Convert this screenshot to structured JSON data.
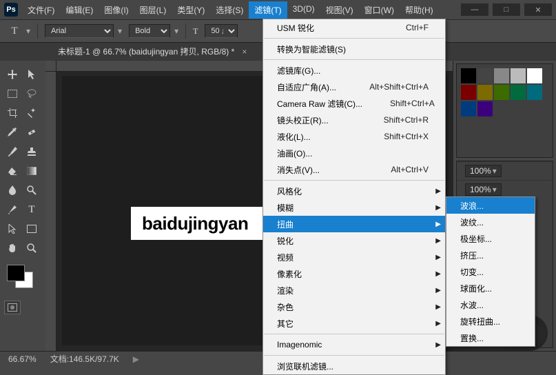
{
  "app_logo": "Ps",
  "menubar": [
    "文件(F)",
    "编辑(E)",
    "图像(I)",
    "图层(L)",
    "类型(Y)",
    "选择(S)",
    "滤镜(T)",
    "3D(D)",
    "视图(V)",
    "窗口(W)",
    "帮助(H)"
  ],
  "active_menu_index": 6,
  "options": {
    "tool_glyph": "T",
    "font_family": "Arial",
    "font_weight": "Bold",
    "size_glyph": "T",
    "size_value": "50 点"
  },
  "document_tab": {
    "label": "未标题-1 @ 66.7% (baidujingyan 拷贝, RGB/8) *",
    "close": "×"
  },
  "canvas_text": "baidujingyan",
  "status": {
    "zoom": "66.67%",
    "doc": "文档:146.5K/97.7K"
  },
  "menu_main": [
    {
      "label": "USM 锐化",
      "shortcut": "Ctrl+F"
    },
    {
      "sep": true
    },
    {
      "label": "转换为智能滤镜(S)"
    },
    {
      "sep": true
    },
    {
      "label": "滤镜库(G)..."
    },
    {
      "label": "自适应广角(A)...",
      "shortcut": "Alt+Shift+Ctrl+A"
    },
    {
      "label": "Camera Raw 滤镜(C)...",
      "shortcut": "Shift+Ctrl+A"
    },
    {
      "label": "镜头校正(R)...",
      "shortcut": "Shift+Ctrl+R"
    },
    {
      "label": "液化(L)...",
      "shortcut": "Shift+Ctrl+X"
    },
    {
      "label": "油画(O)..."
    },
    {
      "label": "消失点(V)...",
      "shortcut": "Alt+Ctrl+V"
    },
    {
      "sep": true
    },
    {
      "label": "风格化",
      "sub": true
    },
    {
      "label": "模糊",
      "sub": true
    },
    {
      "label": "扭曲",
      "sub": true,
      "hov": true
    },
    {
      "label": "锐化",
      "sub": true
    },
    {
      "label": "视频",
      "sub": true
    },
    {
      "label": "像素化",
      "sub": true
    },
    {
      "label": "渲染",
      "sub": true
    },
    {
      "label": "杂色",
      "sub": true
    },
    {
      "label": "其它",
      "sub": true
    },
    {
      "sep": true
    },
    {
      "label": "Imagenomic",
      "sub": true
    },
    {
      "sep": true
    },
    {
      "label": "浏览联机滤镜..."
    }
  ],
  "menu_sub": [
    {
      "label": "波浪...",
      "hov": true
    },
    {
      "label": "波纹..."
    },
    {
      "label": "极坐标..."
    },
    {
      "label": "挤压..."
    },
    {
      "label": "切变..."
    },
    {
      "label": "球面化..."
    },
    {
      "label": "水波..."
    },
    {
      "label": "旋转扭曲..."
    },
    {
      "label": "置换..."
    }
  ],
  "swatches_row1": [
    "#000",
    "#444",
    "#888",
    "#bbb",
    "#fff",
    "#7a0000"
  ],
  "swatches_row2": [
    "#7d6b00",
    "#3c6b00",
    "#006b3c",
    "#006b7d",
    "#003c7d",
    "#3c007d"
  ],
  "right_panel": {
    "opacity_label": "100%",
    "fill_label": "100%"
  }
}
